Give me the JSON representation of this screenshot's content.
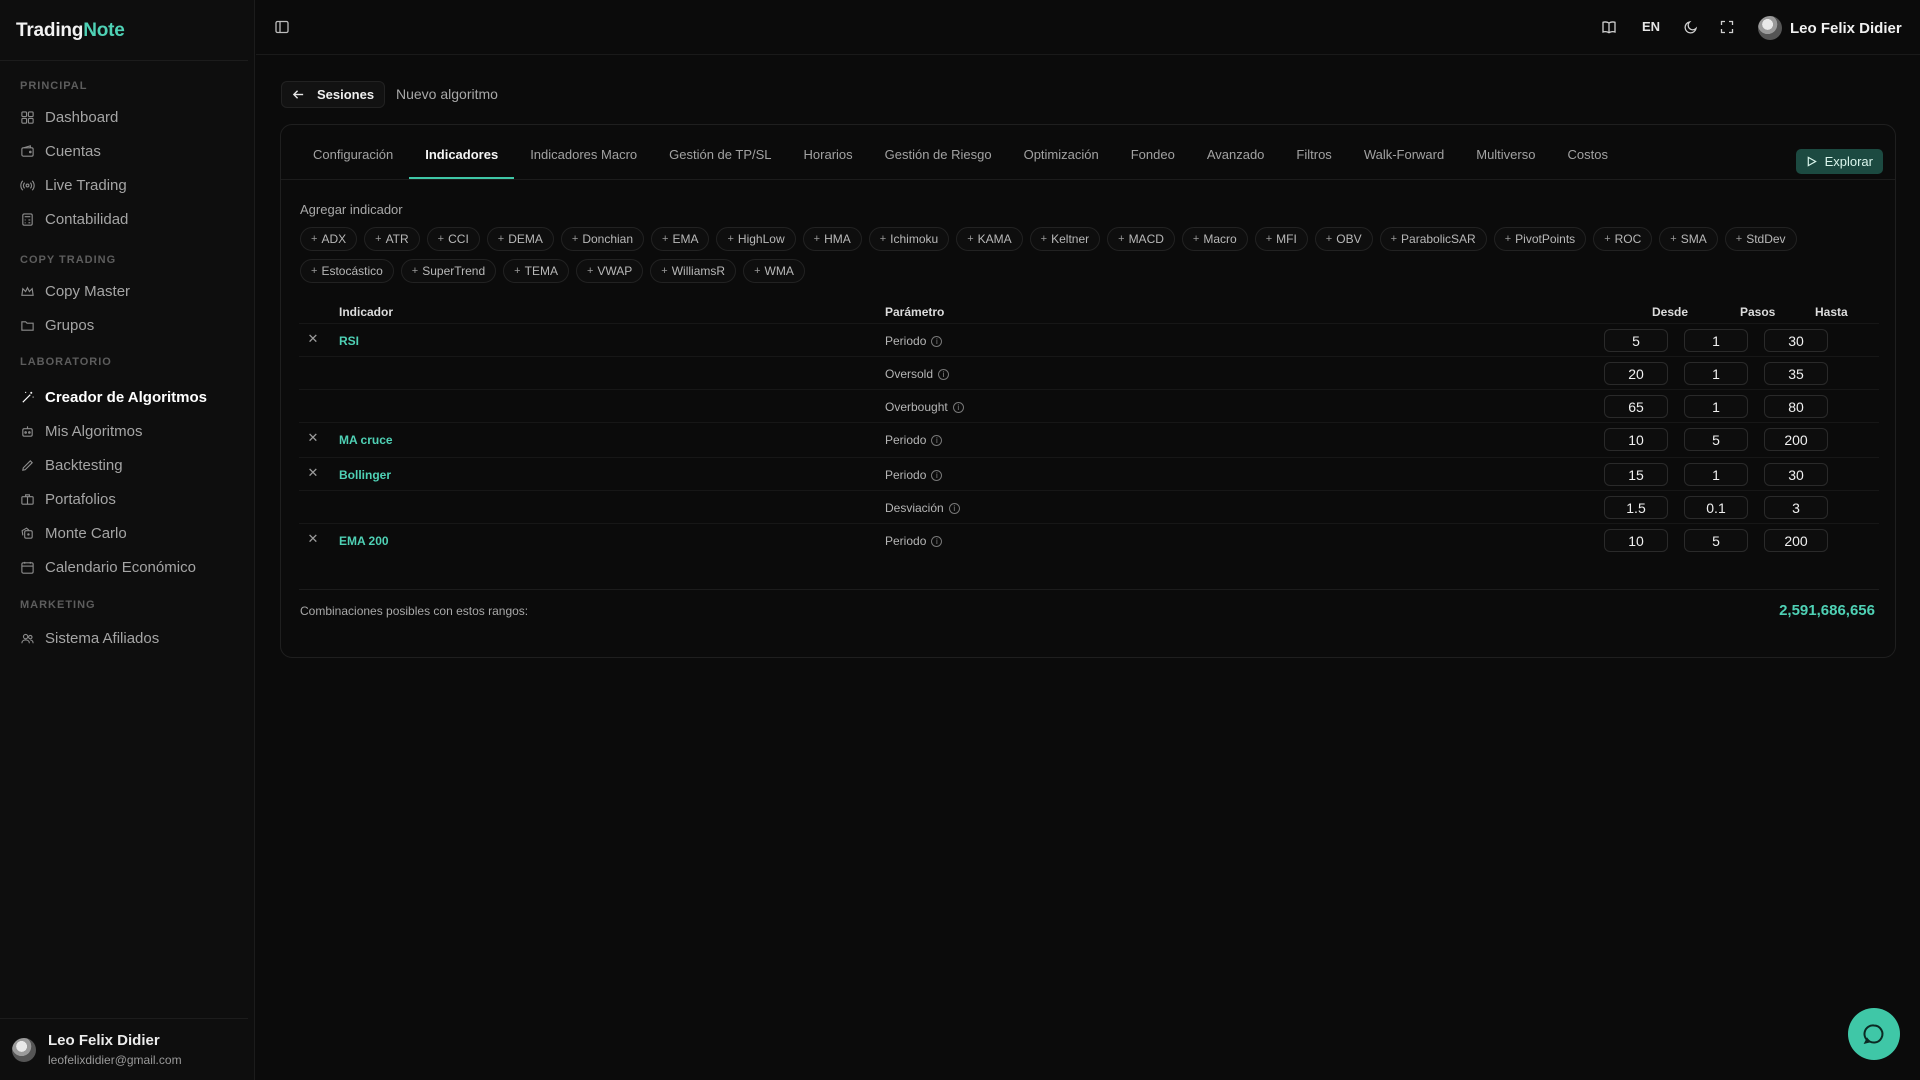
{
  "app": {
    "logo_main": "Trading",
    "logo_accent": "Note",
    "accent_color": "#4fd1b5"
  },
  "sidebar": {
    "sections": [
      {
        "title": "PRINCIPAL",
        "items": [
          {
            "label": "Dashboard",
            "icon": "dashboard-icon"
          },
          {
            "label": "Cuentas",
            "icon": "wallet-icon"
          },
          {
            "label": "Live Trading",
            "icon": "radio-icon"
          },
          {
            "label": "Contabilidad",
            "icon": "calculator-icon"
          }
        ]
      },
      {
        "title": "COPY TRADING",
        "items": [
          {
            "label": "Copy Master",
            "icon": "crown-icon"
          },
          {
            "label": "Grupos",
            "icon": "folder-icon"
          }
        ]
      },
      {
        "title": "LABORATORIO",
        "items": [
          {
            "label": "Creador de Algoritmos",
            "icon": "wand-icon",
            "active": true
          },
          {
            "label": "Mis Algoritmos",
            "icon": "bot-icon"
          },
          {
            "label": "Backtesting",
            "icon": "pencil-icon"
          },
          {
            "label": "Portafolios",
            "icon": "briefcase-icon"
          },
          {
            "label": "Monte Carlo",
            "icon": "dice-icon"
          },
          {
            "label": "Calendario Económico",
            "icon": "calendar-icon"
          }
        ]
      },
      {
        "title": "MARKETING",
        "items": [
          {
            "label": "Sistema Afiliados",
            "icon": "users-icon"
          }
        ]
      }
    ],
    "user": {
      "name": "Leo Felix Didier",
      "email": "leofelixdidier@gmail.com"
    }
  },
  "topbar": {
    "language": "EN",
    "user_name": "Leo Felix Didier"
  },
  "breadcrumb": {
    "back_label": "Sesiones",
    "current": "Nuevo algoritmo"
  },
  "tabs": [
    "Configuración",
    "Indicadores",
    "Indicadores Macro",
    "Gestión de TP/SL",
    "Horarios",
    "Gestión de Riesgo",
    "Optimización",
    "Fondeo",
    "Avanzado",
    "Filtros",
    "Walk-Forward",
    "Multiverso",
    "Costos"
  ],
  "active_tab": "Indicadores",
  "explore_label": "Explorar",
  "add_indicator": {
    "label": "Agregar indicador",
    "chips": [
      "ADX",
      "ATR",
      "CCI",
      "DEMA",
      "Donchian",
      "EMA",
      "HighLow",
      "HMA",
      "Ichimoku",
      "KAMA",
      "Keltner",
      "MACD",
      "Macro",
      "MFI",
      "OBV",
      "ParabolicSAR",
      "PivotPoints",
      "ROC",
      "SMA",
      "StdDev",
      "Estocástico",
      "SuperTrend",
      "TEMA",
      "VWAP",
      "WilliamsR",
      "WMA"
    ]
  },
  "table": {
    "headers": {
      "indicator": "Indicador",
      "parameter": "Parámetro",
      "from": "Desde",
      "step": "Pasos",
      "to": "Hasta"
    },
    "rows": [
      {
        "indicator": "RSI",
        "param": "Periodo",
        "from": "5",
        "step": "1",
        "to": "30",
        "deletable": true
      },
      {
        "indicator": "",
        "param": "Oversold",
        "from": "20",
        "step": "1",
        "to": "35",
        "deletable": false
      },
      {
        "indicator": "",
        "param": "Overbought",
        "from": "65",
        "step": "1",
        "to": "80",
        "deletable": false
      },
      {
        "indicator": "MA cruce",
        "param": "Periodo",
        "from": "10",
        "step": "5",
        "to": "200",
        "deletable": true
      },
      {
        "indicator": "Bollinger",
        "param": "Periodo",
        "from": "15",
        "step": "1",
        "to": "30",
        "deletable": true
      },
      {
        "indicator": "",
        "param": "Desviación",
        "from": "1.5",
        "step": "0.1",
        "to": "3",
        "deletable": false
      },
      {
        "indicator": "EMA 200",
        "param": "Periodo",
        "from": "10",
        "step": "5",
        "to": "200",
        "deletable": true
      }
    ]
  },
  "combinations": {
    "label": "Combinaciones posibles con estos rangos:",
    "value": "2,591,686,656"
  }
}
